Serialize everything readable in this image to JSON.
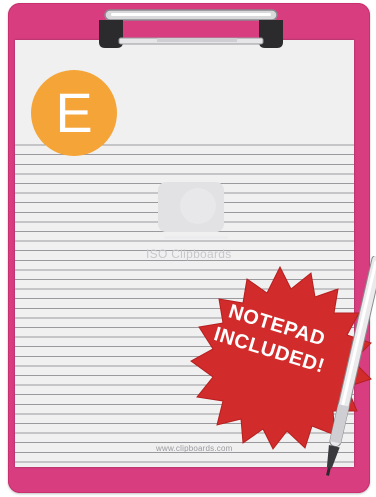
{
  "product": {
    "badge_letter": "E",
    "watermark_text": "ISO Clipboards",
    "footer_url": "www.clipboards.com",
    "promo_line1": "NOTEPAD",
    "promo_line2": "INCLUDED!"
  },
  "colors": {
    "board": "#d83d80",
    "paper": "#f0f0f1",
    "badge": "#f5a437",
    "burst": "#d22b2b",
    "clip": "#c8c8cc"
  },
  "icons": [
    "clip-icon",
    "pen-icon",
    "starburst-icon",
    "watermark-logo-icon"
  ]
}
